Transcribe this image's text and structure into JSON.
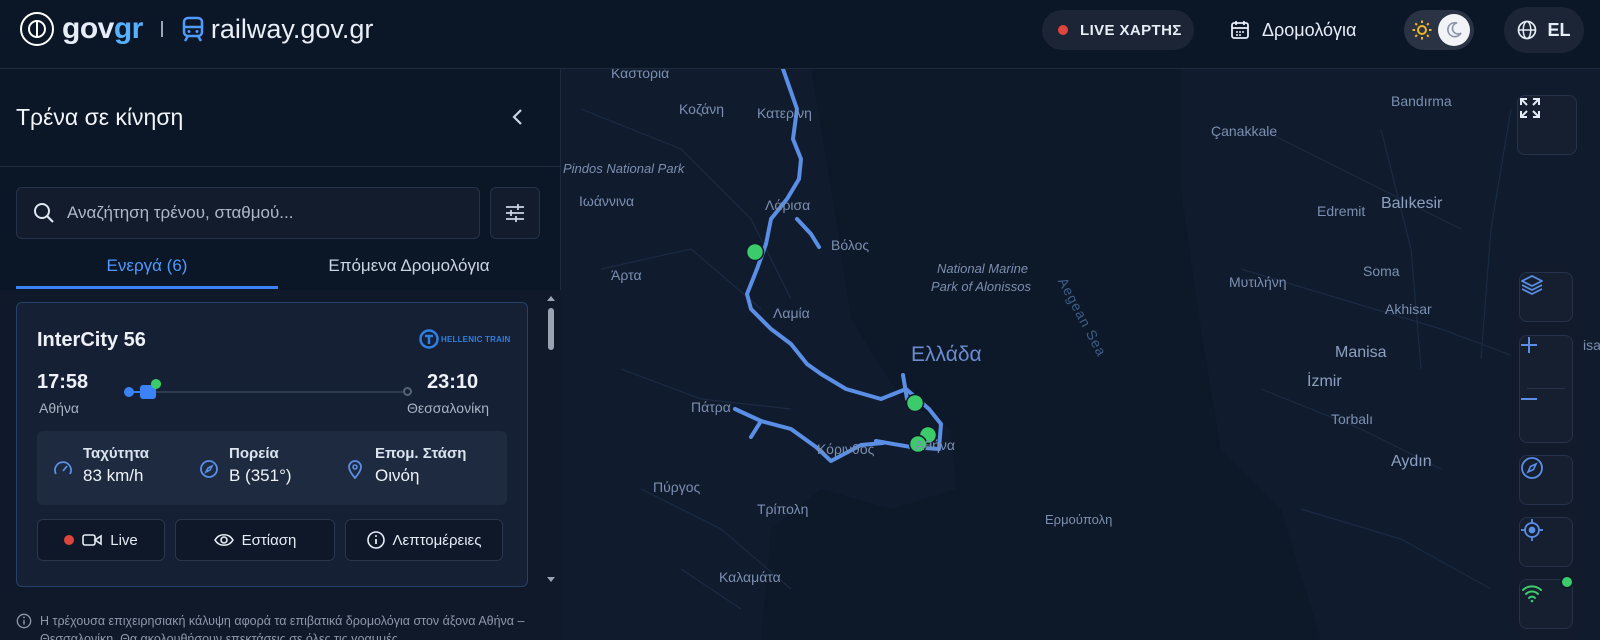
{
  "header": {
    "brand_gov": "gov",
    "brand_gr": "gr",
    "site_name": "railway.gov.gr",
    "live_map": "LIVE ΧΑΡΤΗΣ",
    "schedules": "Δρομολόγια",
    "language": "EL"
  },
  "sidebar": {
    "title": "Τρένα σε κίνηση",
    "search_placeholder": "Αναζήτηση τρένου, σταθμού...",
    "tabs": [
      {
        "label": "Ενεργά (6)",
        "active": true
      },
      {
        "label": "Επόμενα Δρομολόγια",
        "active": false
      }
    ],
    "trains": [
      {
        "name": "InterCity 56",
        "operator": "HELLENIC TRAIN",
        "departure_time": "17:58",
        "departure_station": "Αθήνα",
        "arrival_time": "23:10",
        "arrival_station": "Θεσσαλονίκη",
        "stats": {
          "speed_label": "Ταχύτητα",
          "speed_value": "83 km/h",
          "heading_label": "Πορεία",
          "heading_value": "Β (351°)",
          "next_stop_label": "Επομ. Στάση",
          "next_stop_value": "Οινόη"
        },
        "actions": {
          "live": "Live",
          "focus": "Εστίαση",
          "details": "Λεπτομέρειες"
        }
      }
    ],
    "footnote": "Η τρέχουσα επιχειρησιακή κάλυψη αφορά τα επιβατικά δρομολόγια στον άξονα Αθήνα – Θεσσαλονίκη. Θα ακολουθήσουν επεκτάσεις σε όλες τις γραμμές."
  },
  "map": {
    "places": {
      "kastoria": "Καστοριά",
      "kozani": "Κοζάνη",
      "katerini": "Κατερίνη",
      "pindos": "Pindos National Park",
      "ioannina": "Ιωάννινα",
      "larisa": "Λάρισα",
      "volos": "Βόλος",
      "arta": "Άρτα",
      "lamia": "Λαμία",
      "marine_park_1": "National Marine",
      "marine_park_2": "Park of Alonissos",
      "aegean": "Aegean Sea",
      "country": "Ελλάδα",
      "patra": "Πάτρα",
      "korinthos": "Κόρινθος",
      "athina": "Αθήνα",
      "pyrgos": "Πύργος",
      "tripoli": "Τρίπολη",
      "ermoupoli": "Ερμούπολη",
      "kalamata": "Καλαμάτα",
      "bandirma": "Bandırma",
      "canakkale": "Çanakkale",
      "edremit": "Edremit",
      "balikesir": "Balıkesir",
      "mytilini": "Μυτιλήνη",
      "soma": "Soma",
      "akhisar": "Akhisar",
      "manisa": "Manisa",
      "izmir": "İzmir",
      "torbali": "Torbalı",
      "aydin": "Aydın",
      "manisa_edge": "isa"
    },
    "train_markers": 4
  },
  "colors": {
    "accent": "#3b82f6",
    "live": "#e0453d",
    "train": "#3ccb6a",
    "rail": "#5b8fe6"
  }
}
